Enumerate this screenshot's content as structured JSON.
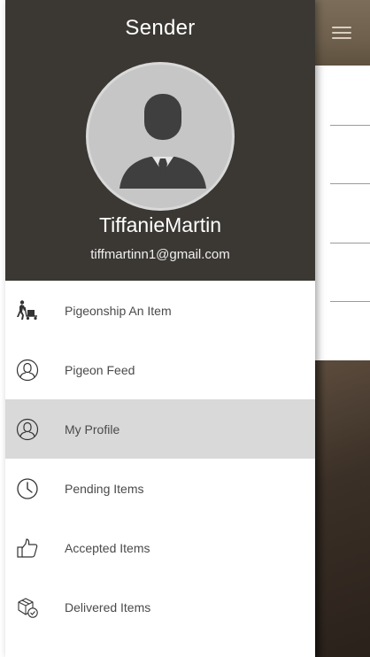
{
  "drawer": {
    "role_title": "Sender",
    "user_name": "TiffanieMartin",
    "user_email": "tiffmartinn1@gmail.com",
    "menu": [
      {
        "label": "Pigeonship An Item",
        "icon": "delivery-person-icon",
        "active": false
      },
      {
        "label": "Pigeon Feed",
        "icon": "person-outline-icon",
        "active": false
      },
      {
        "label": "My Profile",
        "icon": "person-outline-icon",
        "active": true
      },
      {
        "label": "Pending Items",
        "icon": "clock-icon",
        "active": false
      },
      {
        "label": "Accepted Items",
        "icon": "thumbs-up-icon",
        "active": false
      },
      {
        "label": "Delivered Items",
        "icon": "delivered-box-icon",
        "active": false
      }
    ]
  },
  "colors": {
    "header_bg": "#3b3834",
    "active_item_bg": "#d9d9d9",
    "topbar_bg": "#7b6d59"
  }
}
